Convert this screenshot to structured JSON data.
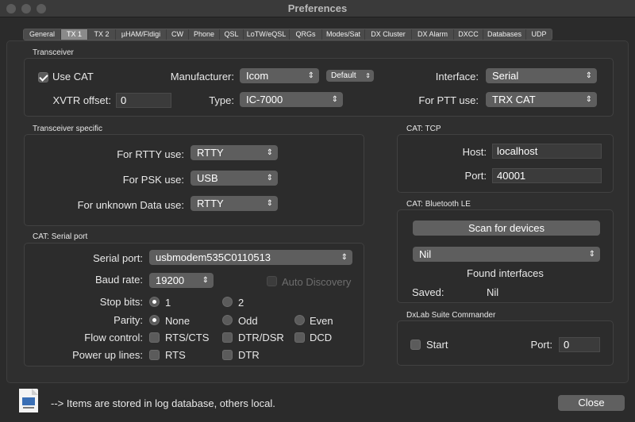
{
  "window": {
    "title": "Preferences"
  },
  "tabs": [
    "General",
    "TX 1",
    "TX 2",
    "µHAM/Fldigi",
    "CW",
    "Phone",
    "QSL",
    "LoTW/eQSL",
    "QRGs",
    "Modes/Sat",
    "DX Cluster",
    "DX Alarm",
    "DXCC",
    "Databases",
    "UDP"
  ],
  "transceiver": {
    "title": "Transceiver",
    "use_cat_label": "Use CAT",
    "use_cat_checked": true,
    "manufacturer_label": "Manufacturer:",
    "manufacturer_value": "Icom",
    "default_label": "Default",
    "interface_label": "Interface:",
    "interface_value": "Serial",
    "xvtr_label": "XVTR offset:",
    "xvtr_value": "0",
    "type_label": "Type:",
    "type_value": "IC-7000",
    "ptt_label": "For PTT use:",
    "ptt_value": "TRX CAT"
  },
  "specific": {
    "title": "Transceiver specific",
    "rtty_label": "For RTTY use:",
    "rtty_value": "RTTY",
    "psk_label": "For PSK use:",
    "psk_value": "USB",
    "unknown_label": "For unknown Data use:",
    "unknown_value": "RTTY"
  },
  "tcp": {
    "title": "CAT: TCP",
    "host_label": "Host:",
    "host_value": "localhost",
    "port_label": "Port:",
    "port_value": "40001"
  },
  "ble": {
    "title": "CAT: Bluetooth LE",
    "scan_label": "Scan for devices",
    "device_value": "Nil",
    "found_label": "Found interfaces",
    "saved_label": "Saved:",
    "saved_value": "Nil"
  },
  "serial": {
    "title": "CAT: Serial port",
    "port_label": "Serial port:",
    "port_value": "usbmodem535C0110513",
    "baud_label": "Baud rate:",
    "baud_value": "19200",
    "auto_label": "Auto Discovery",
    "stop_label": "Stop bits:",
    "stop_1": "1",
    "stop_2": "2",
    "parity_label": "Parity:",
    "parity_none": "None",
    "parity_odd": "Odd",
    "parity_even": "Even",
    "flow_label": "Flow control:",
    "flow_rtscts": "RTS/CTS",
    "flow_dtrdsr": "DTR/DSR",
    "flow_dcd": "DCD",
    "power_label": "Power up lines:",
    "power_rts": "RTS",
    "power_dtr": "DTR"
  },
  "dxlab": {
    "title": "DxLab Suite Commander",
    "start_label": "Start",
    "port_label": "Port:",
    "port_value": "0"
  },
  "footer": {
    "note": "--> Items are stored in log database, others local.",
    "close_label": "Close"
  }
}
